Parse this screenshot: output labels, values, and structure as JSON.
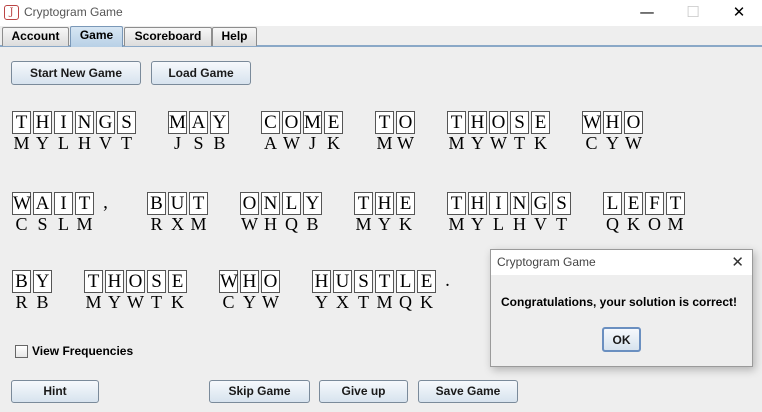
{
  "window": {
    "title": "Cryptogram Game",
    "app_icon_glyph": "J",
    "minimize_glyph": "—",
    "maximize_glyph": "☐",
    "close_glyph": "✕",
    "icons": [
      "java-app-icon",
      "minimize-icon",
      "maximize-icon",
      "close-icon"
    ]
  },
  "tabs": [
    "Account",
    "Game",
    "Scoreboard",
    "Help"
  ],
  "active_tab": "Game",
  "top_buttons": {
    "start_new_game": "Start New Game",
    "load_game": "Load Game"
  },
  "puzzle": {
    "lines": [
      [
        {
          "plain": "THINGS",
          "cipher": "MYLHVT"
        },
        {
          "plain": "MAY",
          "cipher": "JSB"
        },
        {
          "plain": "COME",
          "cipher": "AWJK"
        },
        {
          "plain": "TO",
          "cipher": "MW"
        },
        {
          "plain": "THOSE",
          "cipher": "MYWTK"
        },
        {
          "plain": "WHO",
          "cipher": "CYW"
        }
      ],
      [
        {
          "plain": "WAIT,",
          "cipher": "CSLM"
        },
        {
          "plain": "BUT",
          "cipher": "RXM"
        },
        {
          "plain": "ONLY",
          "cipher": "WHQB"
        },
        {
          "plain": "THE",
          "cipher": "MYK"
        },
        {
          "plain": "THINGS",
          "cipher": "MYLHVT"
        },
        {
          "plain": "LEFT",
          "cipher": "QKOM"
        }
      ],
      [
        {
          "plain": "BY",
          "cipher": "RB"
        },
        {
          "plain": "THOSE",
          "cipher": "MYWTK"
        },
        {
          "plain": "WHO",
          "cipher": "CYW"
        },
        {
          "plain": "HUSTLE.",
          "cipher": "YXTMQK"
        }
      ]
    ]
  },
  "view_frequencies": {
    "label": "View Frequencies",
    "checked": false
  },
  "bottom_buttons": {
    "hint": "Hint",
    "skip_game": "Skip Game",
    "give_up": "Give up",
    "save_game": "Save Game"
  },
  "dialog": {
    "title": "Cryptogram Game",
    "message": "Congratulations, your solution is correct!",
    "ok": "OK",
    "close_glyph": "✕"
  },
  "colors": {
    "tab_active": "#b8d0e6",
    "button_top": "#f6f9fc",
    "button_bottom": "#d7e3ee",
    "ok_border": "#6a8fc0"
  }
}
